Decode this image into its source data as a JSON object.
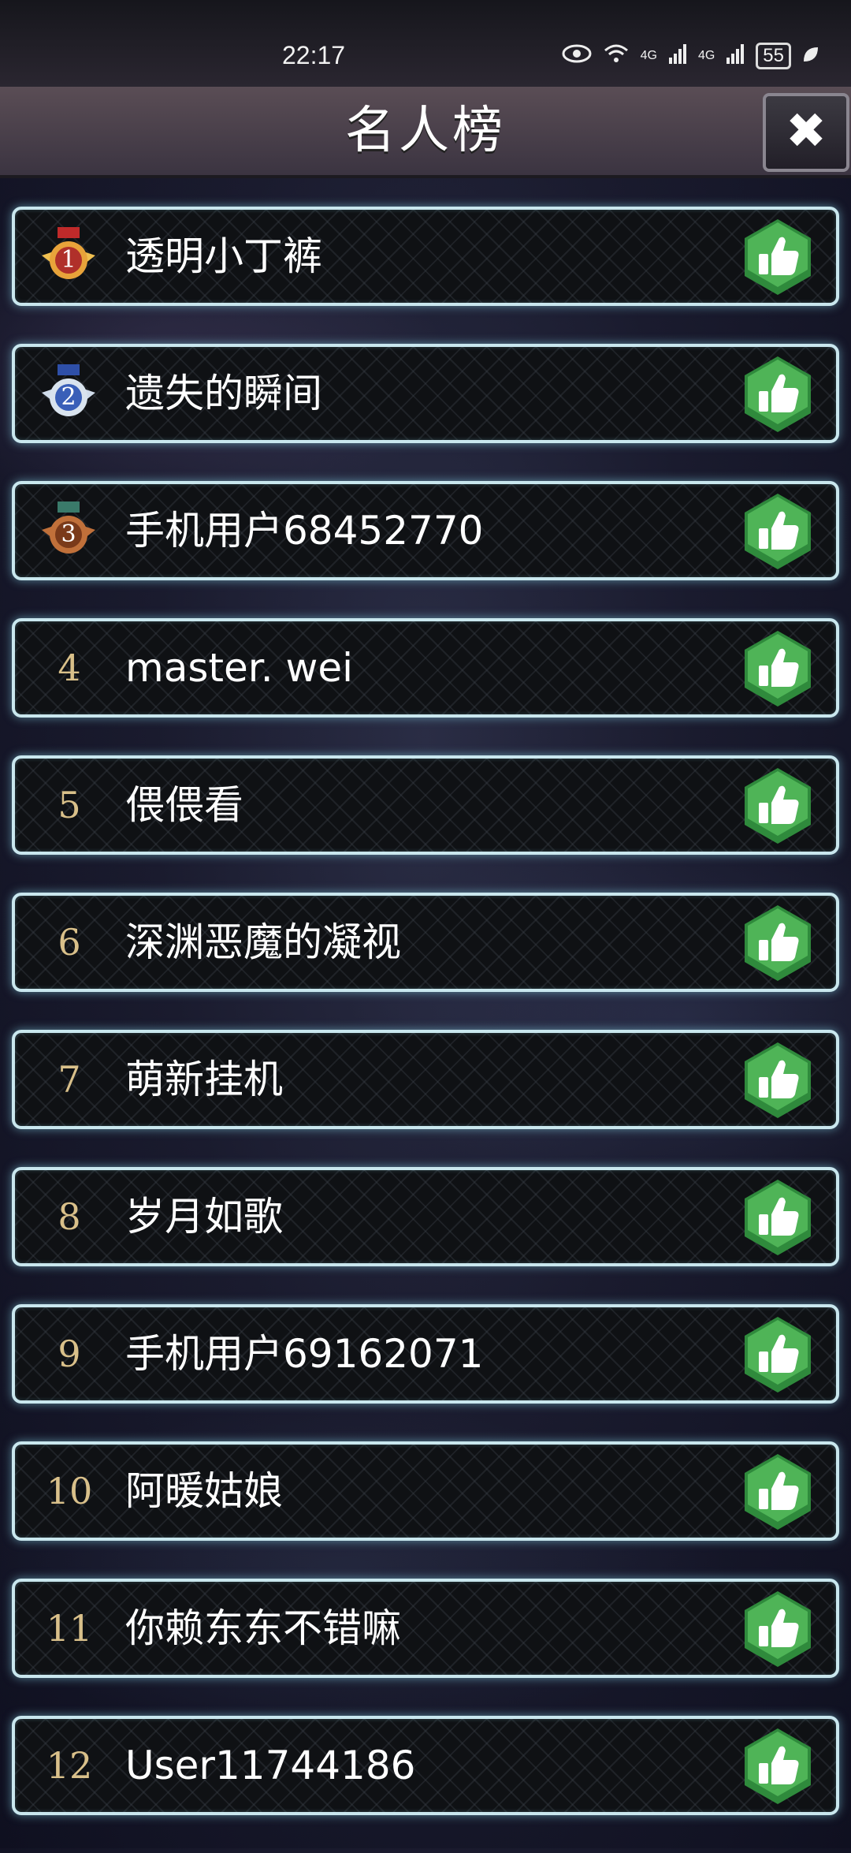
{
  "status": {
    "time": "22:17",
    "signal1": "4G",
    "signal2": "4G",
    "battery": "55"
  },
  "header": {
    "title": "名人榜",
    "close_icon": "close-icon"
  },
  "colors": {
    "rank_gold": "#d9c08a",
    "border_glow": "#c9e7ee",
    "like_green": "#4caf50"
  },
  "rows": [
    {
      "rank": "1",
      "medal": "gold-medal-icon",
      "name": "透明小丁裤"
    },
    {
      "rank": "2",
      "medal": "silver-medal-icon",
      "name": "遗失的瞬间"
    },
    {
      "rank": "3",
      "medal": "bronze-medal-icon",
      "name": "手机用户68452770"
    },
    {
      "rank": "4",
      "name": "master. wei"
    },
    {
      "rank": "5",
      "name": "偎偎看"
    },
    {
      "rank": "6",
      "name": "深渊恶魔的凝视"
    },
    {
      "rank": "7",
      "name": "萌新挂机"
    },
    {
      "rank": "8",
      "name": "岁月如歌"
    },
    {
      "rank": "9",
      "name": "手机用户69162071"
    },
    {
      "rank": "10",
      "name": "阿暖姑娘"
    },
    {
      "rank": "11",
      "name": "你赖东东不错嘛"
    },
    {
      "rank": "12",
      "name": "User11744186"
    }
  ]
}
